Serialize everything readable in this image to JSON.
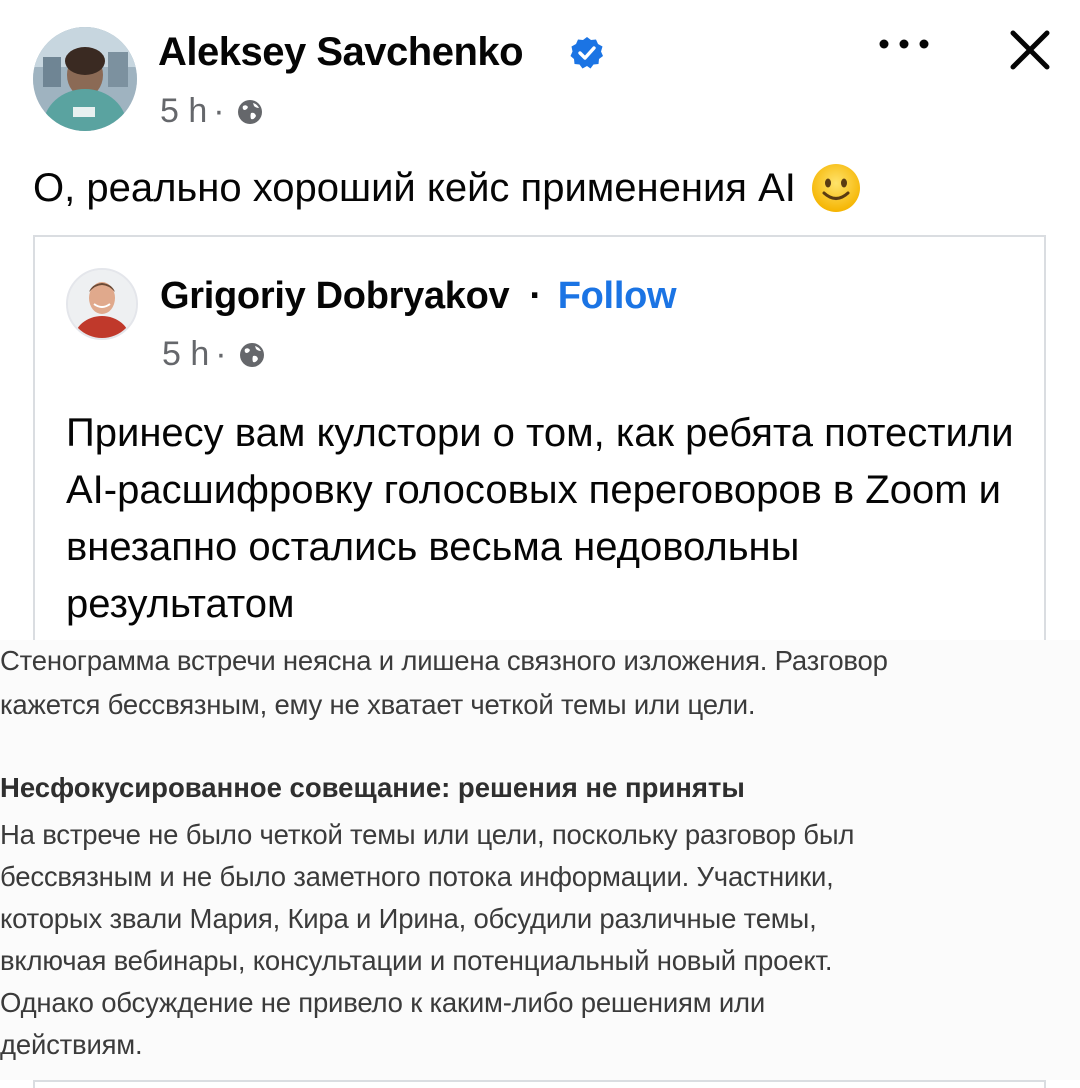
{
  "post": {
    "author": "Aleksey Savchenko",
    "time": "5 h",
    "separator": "·",
    "audience_icon": "globe-icon",
    "verified_icon": "verified-badge-icon",
    "more_icon": "more-options-icon",
    "close_icon": "close-icon",
    "text": "О, реально хороший кейс применения AI",
    "emoji": "smiling-face-emoji"
  },
  "shared": {
    "author": "Grigoriy Dobryakov",
    "separator": "·",
    "follow_label": "Follow",
    "time": "5 h",
    "audience_icon": "globe-icon",
    "text": "Принесу вам кулстори о том, как ребята потестили AI-расшифровку голосовых переговоров в Zoom и внезапно остались весьма недовольны результатом"
  },
  "embedded_screenshot": {
    "para1": [
      "Стенограмма встречи неясна и лишена связного изложения. Разговор",
      "кажется бессвязным, ему не хватает четкой темы или цели."
    ],
    "heading": "Несфокусированное совещание: решения не приняты",
    "para2": [
      "На встрече не было четкой темы или цели, поскольку разговор был",
      "бессвязным и не было заметного потока информации. Участники,",
      "которых звали Мария, Кира и Ирина, обсудили различные темы,",
      "включая вебинары, консультации и потенциальный новый проект.",
      "Однако обсуждение не привело к каким-либо решениям или",
      "действиям."
    ]
  },
  "colors": {
    "accent": "#1b74e4",
    "secondary_text": "#65676b",
    "border": "#dadde1"
  }
}
